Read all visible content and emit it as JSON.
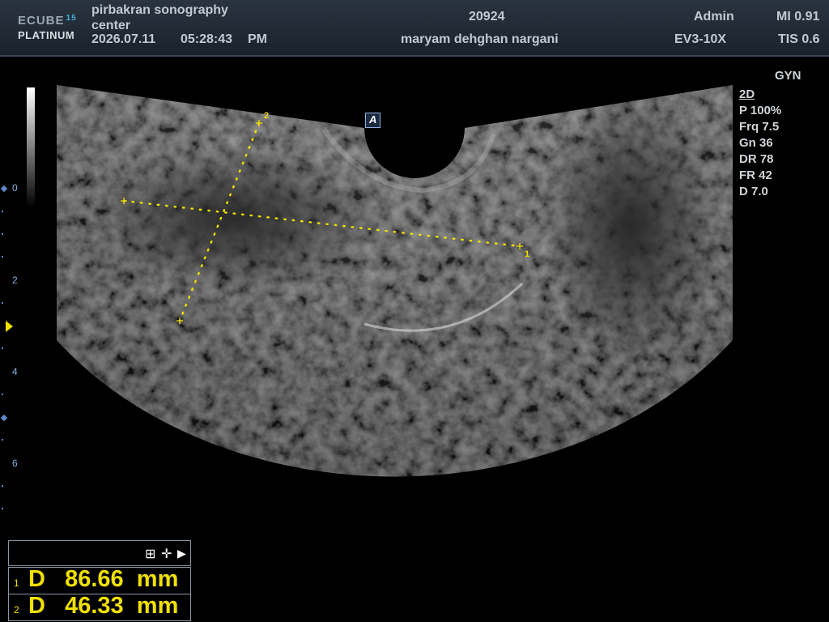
{
  "header": {
    "logo_line1": "ECUBE",
    "logo_num": "15",
    "logo_line2": "PLATINUM",
    "institution": "pirbakran sonography center",
    "date": "2026.07.11",
    "time": "05:28:43",
    "ampm": "PM",
    "patient_id": "20924",
    "patient_name": "maryam dehghan nargani",
    "user": "Admin",
    "probe": "EV3-10X",
    "mi": "MI 0.91",
    "tis": "TIS 0.6"
  },
  "params": {
    "preset": "GYN",
    "mode": "2D",
    "power": "P 100%",
    "freq": "Frq 7.5",
    "gain": "Gn 36",
    "dr": "DR 78",
    "fr": "FR 42",
    "depth": "D 7.0"
  },
  "depth_scale": [
    "0",
    "2",
    "4",
    "6"
  ],
  "orientation_marker": "A",
  "measurements": [
    {
      "index": "1",
      "text": "D   86.66  mm"
    },
    {
      "index": "2",
      "text": "D   46.33  mm"
    }
  ],
  "caliper_labels": [
    "1",
    "2"
  ],
  "toolbar_icons": [
    "grid-icon",
    "move-icon",
    "play-icon"
  ],
  "colors": {
    "caliper": "#f0e000",
    "header_bg": "#1f2832",
    "scale_marks": "#5e86c8"
  }
}
